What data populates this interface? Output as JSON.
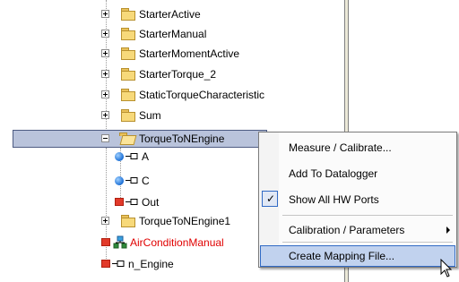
{
  "tree": {
    "items": [
      {
        "label": "StarterActive",
        "icon": "folder-icon",
        "expander": "plus"
      },
      {
        "label": "StarterManual",
        "icon": "folder-icon",
        "expander": "plus"
      },
      {
        "label": "StarterMomentActive",
        "icon": "folder-icon",
        "expander": "plus"
      },
      {
        "label": "StarterTorque_2",
        "icon": "folder-icon",
        "expander": "plus"
      },
      {
        "label": "StaticTorqueCharacteristic",
        "icon": "folder-icon",
        "expander": "plus"
      },
      {
        "label": "Sum",
        "icon": "folder-icon",
        "expander": "plus"
      },
      {
        "label": "TorqueToNEngine",
        "icon": "open-folder-icon",
        "expander": "minus",
        "selected": true
      },
      {
        "label": "A",
        "icon": "blue-input-dot-icon"
      },
      {
        "label": "C",
        "icon": "blue-input-dot-icon"
      },
      {
        "label": "Out",
        "icon": "red-output-square-icon"
      },
      {
        "label": "TorqueToNEngine1",
        "icon": "folder-icon",
        "expander": "plus"
      },
      {
        "label": "AirConditionManual",
        "icon": "network-module-icon",
        "color": "#e00000"
      },
      {
        "label": "n_Engine",
        "icon": "red-output-square-icon"
      }
    ]
  },
  "context_menu": {
    "items": [
      {
        "label": "Measure / Calibrate..."
      },
      {
        "label": "Add To Datalogger"
      },
      {
        "label": "Show All HW Ports",
        "checked": true
      },
      {
        "label": "Calibration / Parameters",
        "submenu": true
      },
      {
        "label": "Create Mapping File...",
        "highlighted": true
      }
    ]
  },
  "colors": {
    "selection": "#b9c3db",
    "menu_highlight": "#c1d2ee",
    "red_text": "#e00000"
  }
}
